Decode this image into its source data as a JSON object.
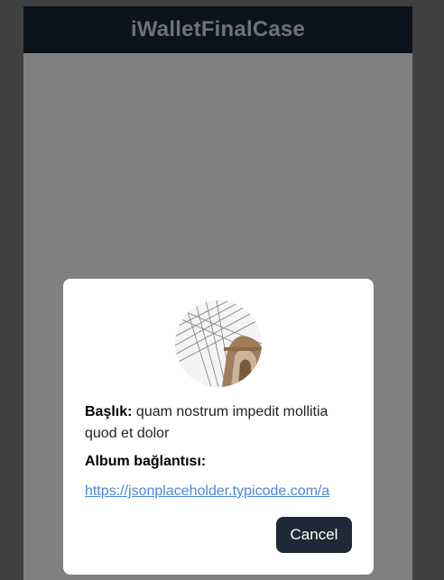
{
  "app": {
    "title": "iWalletFinalCase"
  },
  "modal": {
    "title_label": "Başlık:",
    "title_value": "quam nostrum impedit mollitia quod et dolor",
    "album_label": "Album bağlantısı:",
    "album_link": "https://jsonplaceholder.typicode.com/a",
    "cancel_label": "Cancel",
    "image_icon": "album-thumbnail-bridge"
  },
  "colors": {
    "page_background": "#404040",
    "overlay": "#808080",
    "header": "#0d131a",
    "header_text": "#6f7276",
    "modal_background": "#ffffff",
    "link": "#4a86d9",
    "button": "#1f2837"
  }
}
